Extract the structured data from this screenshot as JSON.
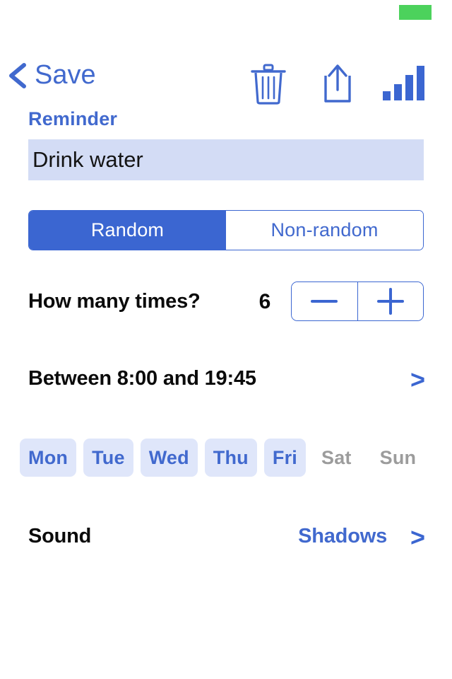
{
  "status_bar": {
    "indicator_color": "#4CD25C"
  },
  "nav": {
    "back_label": "Save",
    "back_icon": "chevron-left-icon",
    "accent_color": "#4169CE",
    "icons": [
      {
        "name": "trash-icon",
        "label": "Delete"
      },
      {
        "name": "share-icon",
        "label": "Share"
      },
      {
        "name": "signal-bars-icon",
        "label": "Signal"
      }
    ]
  },
  "form": {
    "reminder_label": "Reminder",
    "reminder_value": "Drink water",
    "reminder_placeholder": "Reminder",
    "input_bg": "#D3DCF5"
  },
  "mode_segments": {
    "options": [
      "Random",
      "Non-random"
    ],
    "selected": "Random",
    "selected_index": 0,
    "active_bg": "#3B66D1",
    "active_text": "#FFFFFF",
    "inactive_text": "#4169CE"
  },
  "count_row": {
    "label": "How many times?",
    "value": "6",
    "decrement_glyph": "minus-icon",
    "increment_glyph": "plus-icon"
  },
  "time_row": {
    "label": "Between 8:00 and 19:45",
    "start_time": "8:00",
    "end_time": "19:45",
    "chevron": ">"
  },
  "days": {
    "items": [
      {
        "label": "Mon",
        "selected": true
      },
      {
        "label": "Tue",
        "selected": true
      },
      {
        "label": "Wed",
        "selected": true
      },
      {
        "label": "Thu",
        "selected": true
      },
      {
        "label": "Fri",
        "selected": true
      },
      {
        "label": "Sat",
        "selected": false
      },
      {
        "label": "Sun",
        "selected": false
      }
    ],
    "on_bg": "#DFE6FA",
    "on_text": "#4169CE",
    "off_text": "#9C9C9C"
  },
  "sound_row": {
    "label": "Sound",
    "value": "Shadows",
    "chevron": ">"
  }
}
